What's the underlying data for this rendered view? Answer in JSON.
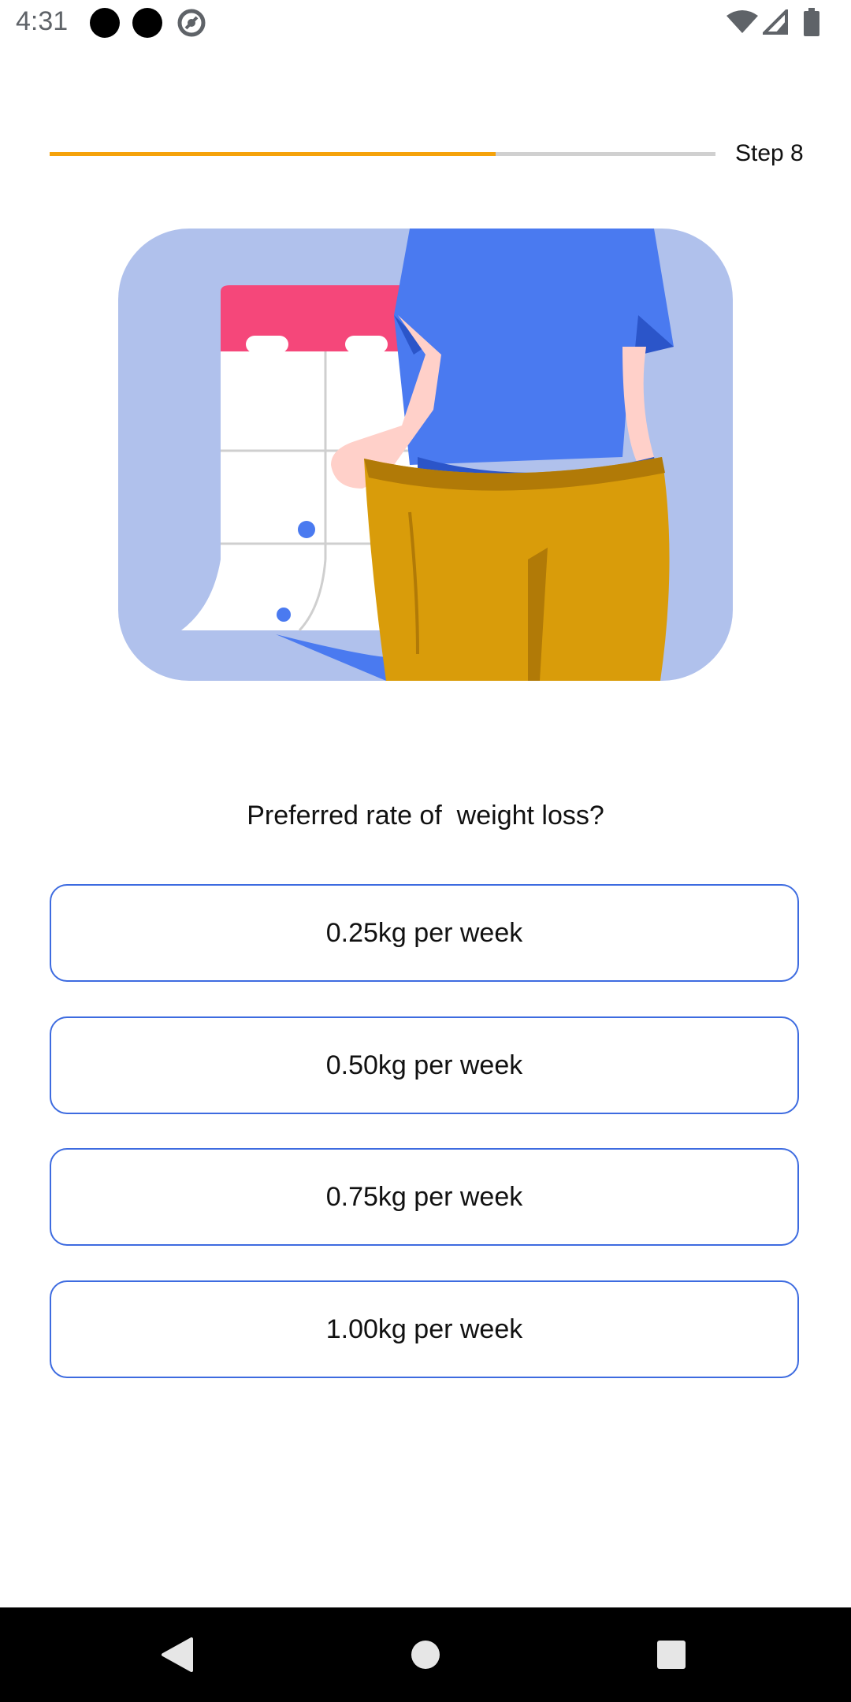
{
  "status_bar": {
    "time": "4:31"
  },
  "progress": {
    "step_label": "Step 8",
    "fraction": 0.67
  },
  "colors": {
    "accent": "#f5a20a",
    "option_border": "#3d6be0",
    "hero_bg": "#b0c1ec"
  },
  "question": "Preferred rate of  weight loss?",
  "options": [
    {
      "label": "0.25kg per week"
    },
    {
      "label": "0.50kg per week"
    },
    {
      "label": "0.75kg per week"
    },
    {
      "label": "1.00kg per week"
    }
  ],
  "nav": {
    "back_icon": "back-triangle-icon",
    "home_icon": "home-circle-icon",
    "recent_icon": "recents-square-icon"
  }
}
